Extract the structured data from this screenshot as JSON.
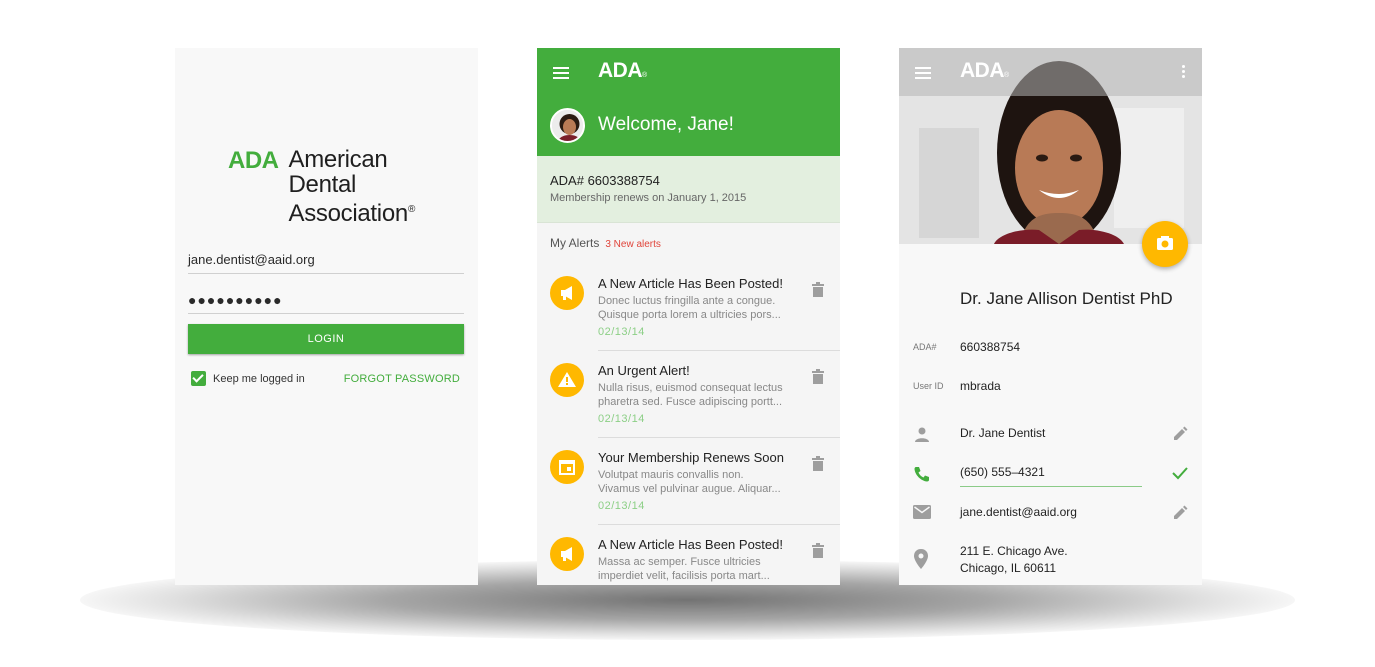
{
  "login_screen": {
    "logo_short": "ADA",
    "logo_lines": [
      "American",
      "Dental",
      "Association"
    ],
    "registered_mark": "®",
    "email_value": "jane.dentist@aaid.org",
    "password_mask": "●●●●●●●●●●",
    "login_button": "LOGIN",
    "keep_logged_in": "Keep me logged in",
    "keep_logged_in_checked": true,
    "forgot_password": "FORGOT PASSWORD"
  },
  "alerts_screen": {
    "appbar_title": "ADA",
    "welcome": "Welcome, Jane!",
    "member_number": "ADA# 6603388754",
    "renewal": "Membership renews on January 1, 2015",
    "alerts_heading": "My Alerts",
    "alerts_count": "3 New alerts",
    "alerts": [
      {
        "icon": "megaphone-icon",
        "title": "A New Article Has Been Posted!",
        "body_1": "Donec luctus fringilla ante a congue.",
        "body_2": "Quisque porta lorem a ultricies pors...",
        "date": "02/13/14"
      },
      {
        "icon": "warning-icon",
        "title": "An Urgent Alert!",
        "body_1": "Nulla risus, euismod consequat lectus",
        "body_2": "pharetra sed. Fusce adipiscing portt...",
        "date": "02/13/14"
      },
      {
        "icon": "calendar-icon",
        "title": "Your Membership Renews Soon",
        "body_1": "Volutpat mauris convallis non.",
        "body_2": "Vivamus vel pulvinar augue. Aliquar...",
        "date": "02/13/14"
      },
      {
        "icon": "megaphone-icon",
        "title": "A New Article Has Been Posted!",
        "body_1": "Massa ac semper. Fusce ultricies",
        "body_2": "imperdiet velit, facilisis porta mart...",
        "date": ""
      }
    ]
  },
  "profile_screen": {
    "appbar_title": "ADA",
    "name": "Dr. Jane Allison Dentist PhD",
    "ada_label": "ADA#",
    "ada_value": "660388754",
    "userid_label": "User ID",
    "userid_value": "mbrada",
    "display_name": "Dr. Jane Dentist",
    "phone": "(650) 555–4321",
    "email": "jane.dentist@aaid.org",
    "address_line1": "211 E. Chicago Ave.",
    "address_line2": "Chicago, IL 60611"
  },
  "colors": {
    "brand_green": "#43ad3d",
    "alert_amber": "#ffb800",
    "urgent_red": "#e0453b"
  }
}
